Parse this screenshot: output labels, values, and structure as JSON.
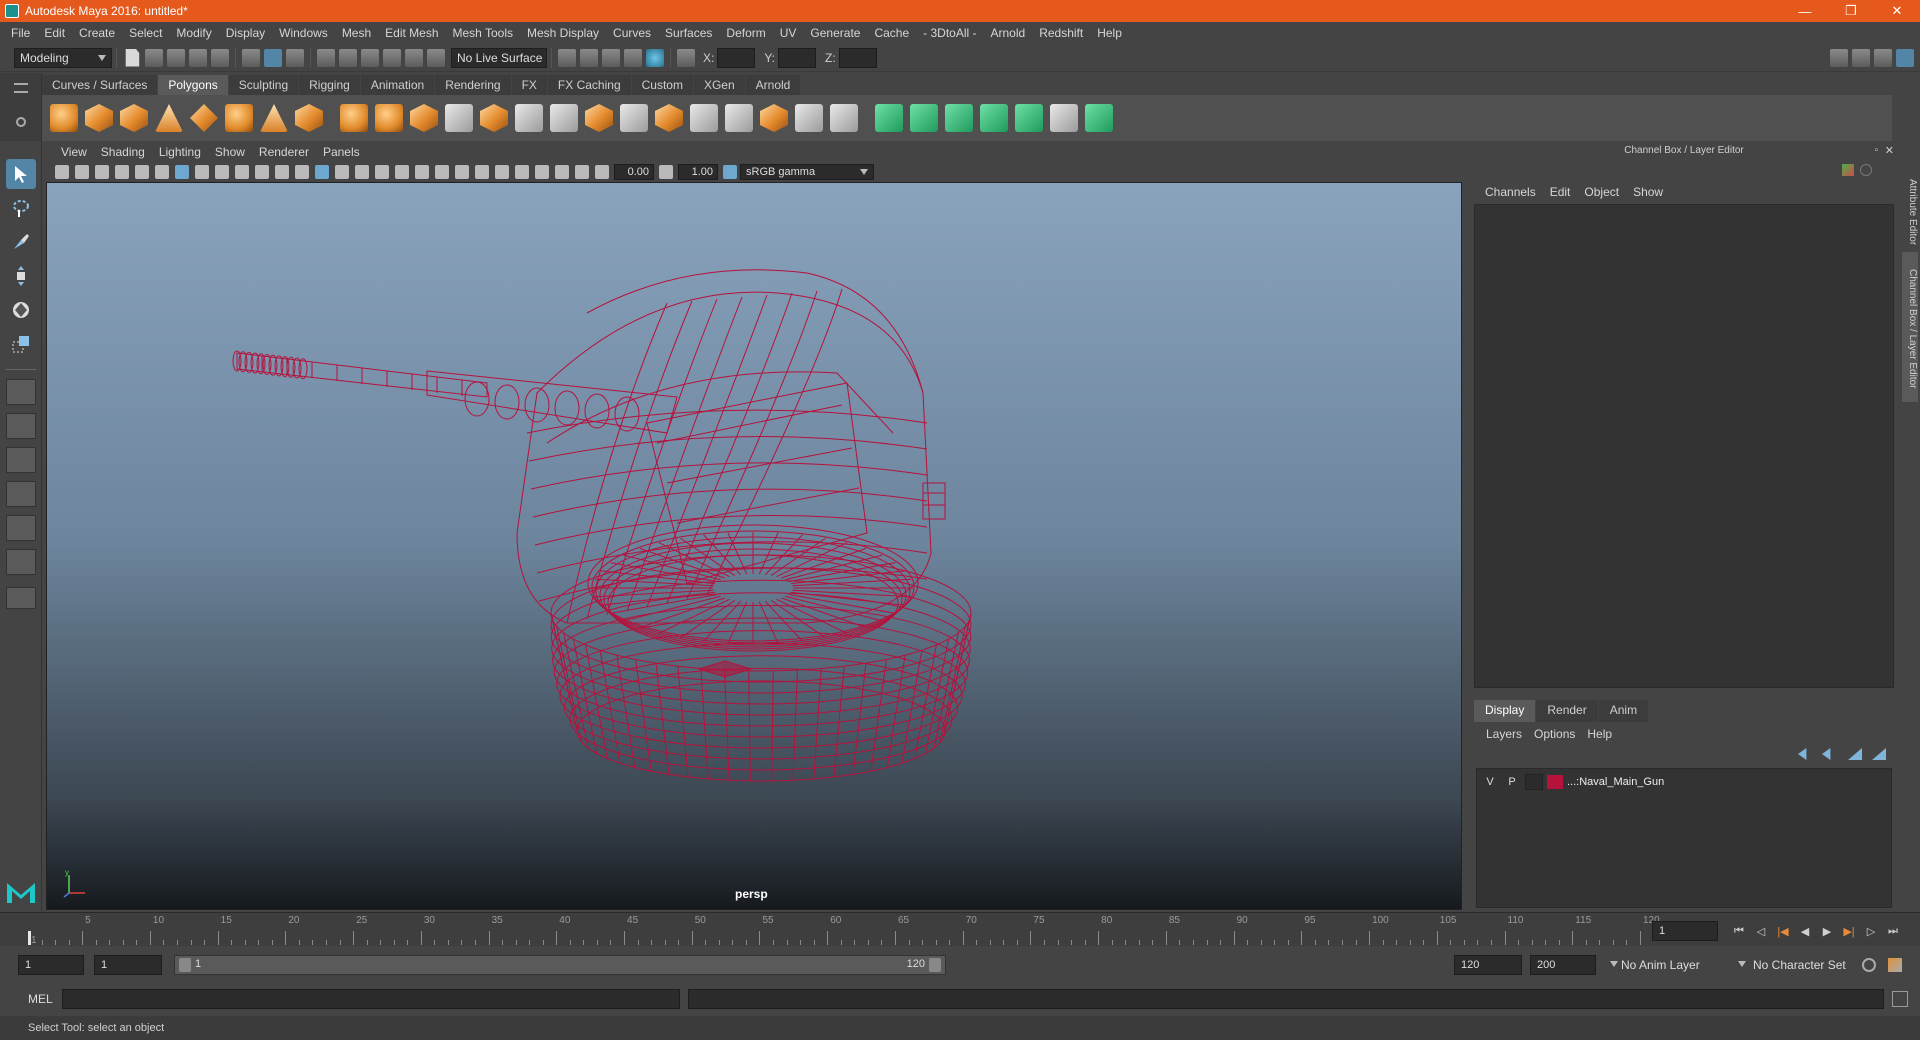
{
  "window": {
    "title": "Autodesk Maya 2016: untitled*",
    "buttons": [
      "—",
      "❐",
      "✕"
    ]
  },
  "menubar": [
    "File",
    "Edit",
    "Create",
    "Select",
    "Modify",
    "Display",
    "Windows",
    "Mesh",
    "Edit Mesh",
    "Mesh Tools",
    "Mesh Display",
    "Curves",
    "Surfaces",
    "Deform",
    "UV",
    "Generate",
    "Cache",
    "- 3DtoAll -",
    "Arnold",
    "Redshift",
    "Help"
  ],
  "statusline": {
    "mode": "Modeling",
    "live_surface": "No Live Surface",
    "x_label": "X:",
    "y_label": "Y:",
    "z_label": "Z:"
  },
  "shelf": {
    "tabs": [
      "Curves / Surfaces",
      "Polygons",
      "Sculpting",
      "Rigging",
      "Animation",
      "Rendering",
      "FX",
      "FX Caching",
      "Custom",
      "XGen",
      "Arnold"
    ],
    "active_tab": "Polygons"
  },
  "viewport": {
    "menus": [
      "View",
      "Shading",
      "Lighting",
      "Show",
      "Renderer",
      "Panels"
    ],
    "exposure": "0.00",
    "gamma": "1.00",
    "color_space": "sRGB gamma",
    "camera_label": "persp",
    "axis_y": "y",
    "wire_color": "#b5123c"
  },
  "channelbox": {
    "title": "Channel Box / Layer Editor",
    "menus": [
      "Channels",
      "Edit",
      "Object",
      "Show"
    ],
    "side_tabs": [
      "Attribute Editor",
      "Channel Box / Layer Editor"
    ]
  },
  "layers": {
    "tabs": [
      "Display",
      "Render",
      "Anim"
    ],
    "active_tab": "Display",
    "menus": [
      "Layers",
      "Options",
      "Help"
    ],
    "rows": [
      {
        "v": "V",
        "p": "P",
        "color": "#b5123c",
        "name": "...:Naval_Main_Gun"
      }
    ]
  },
  "timeline": {
    "tick_labels": [
      "1",
      "5",
      "10",
      "15",
      "20",
      "25",
      "30",
      "35",
      "40",
      "45",
      "50",
      "55",
      "60",
      "65",
      "70",
      "75",
      "80",
      "85",
      "90",
      "95",
      "100",
      "105",
      "110",
      "115",
      "120"
    ],
    "current_frame": "1"
  },
  "range": {
    "start": "1",
    "playback_start": "1",
    "slider_start": "1",
    "slider_end": "120",
    "playback_end": "120",
    "end": "200",
    "anim_layer": "No Anim Layer",
    "character_set": "No Character Set"
  },
  "command": {
    "label": "MEL"
  },
  "help_line": "Select Tool: select an object"
}
